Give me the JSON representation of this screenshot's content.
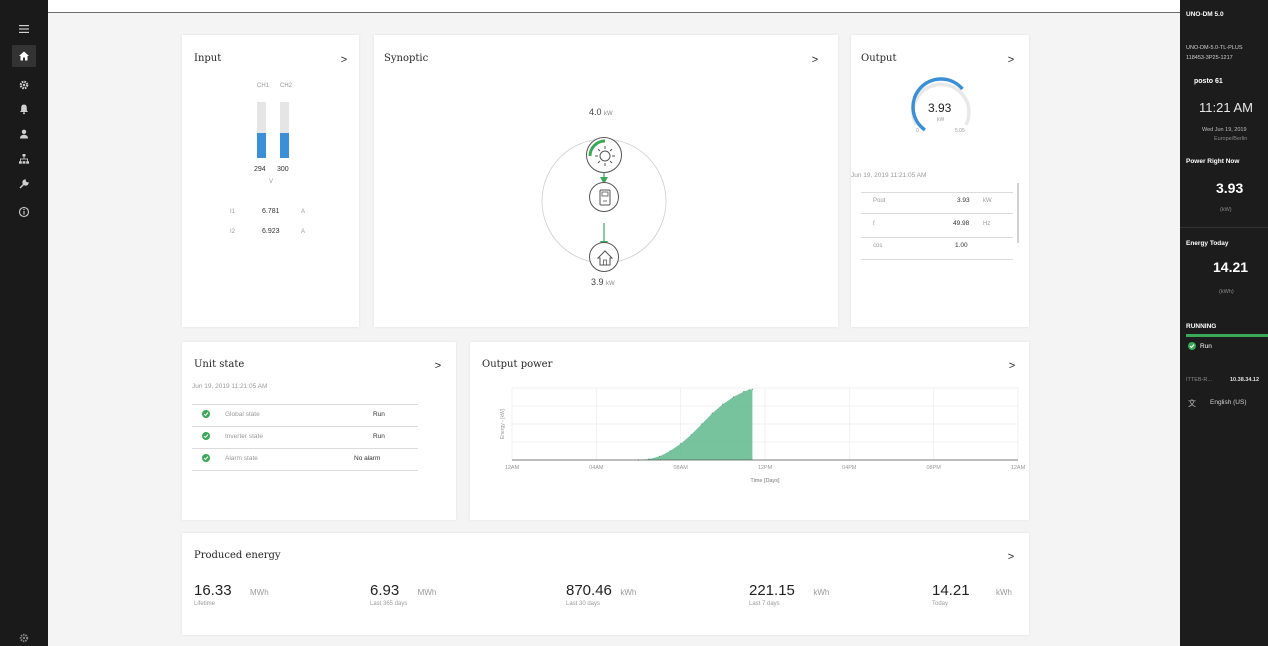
{
  "nav": {
    "items": [
      "menu-icon",
      "home-icon",
      "settings-icon",
      "notifications-icon",
      "user-icon",
      "network-icon",
      "tools-icon",
      "info-icon"
    ],
    "bottom_icon": "gear-icon"
  },
  "input": {
    "title": "Input",
    "channels": [
      "CH1",
      "CH2"
    ],
    "voltages": [
      "294",
      "300"
    ],
    "unit": "V",
    "bar_fill": [
      0.45,
      0.45
    ],
    "currents": [
      {
        "label": "I1",
        "value": "6.781",
        "unit": "A"
      },
      {
        "label": "I2",
        "value": "6.923",
        "unit": "A"
      }
    ]
  },
  "synoptic": {
    "title": "Synoptic",
    "top_value": "4.0",
    "top_unit": "kW",
    "bottom_value": "3.9",
    "bottom_unit": "kW"
  },
  "output": {
    "title": "Output",
    "gauge_value": "3.93",
    "gauge_unit": "kW",
    "gauge_min": "0",
    "gauge_max": "5.05",
    "gauge_fraction": 0.78,
    "timestamp": "Jun 19, 2019 11:21:05 AM",
    "rows": [
      {
        "label": "Pout",
        "value": "3.93",
        "unit": "kW"
      },
      {
        "label": "f",
        "value": "49.98",
        "unit": "Hz"
      },
      {
        "label": "cos",
        "value": "1.00",
        "unit": ""
      }
    ]
  },
  "unit_state": {
    "title": "Unit state",
    "timestamp": "Jun 19, 2019 11:21:05 AM",
    "rows": [
      {
        "label": "Global state",
        "value": "Run"
      },
      {
        "label": "Inverter state",
        "value": "Run"
      },
      {
        "label": "Alarm state",
        "value": "No alarm"
      }
    ]
  },
  "output_power": {
    "title": "Output power",
    "ylabel": "Energy - [kW]",
    "xlabel": "Time [Days]",
    "x_ticks": [
      "12AM",
      "04AM",
      "08AM",
      "12PM",
      "04PM",
      "08PM",
      "12AM"
    ]
  },
  "chart_data": {
    "type": "area",
    "xlabel": "Time [Days]",
    "ylabel": "Energy - [kW]",
    "x": [
      6.0,
      6.5,
      7.0,
      7.5,
      8.0,
      8.5,
      9.0,
      9.5,
      10.0,
      10.5,
      11.0,
      11.25,
      11.4
    ],
    "values": [
      0.0,
      0.05,
      0.2,
      0.5,
      0.9,
      1.4,
      2.0,
      2.6,
      3.1,
      3.5,
      3.8,
      3.9,
      3.93
    ],
    "xlim": [
      0,
      24
    ],
    "ylim": [
      0,
      4
    ],
    "color": "#5fb88c",
    "grid": true
  },
  "produced_energy": {
    "title": "Produced energy",
    "items": [
      {
        "value": "16.33",
        "unit": "MWh",
        "label": "Lifetime"
      },
      {
        "value": "6.93",
        "unit": "MWh",
        "label": "Last 365 days"
      },
      {
        "value": "870.46",
        "unit": "kWh",
        "label": "Last 30 days"
      },
      {
        "value": "221.15",
        "unit": "kWh",
        "label": "Last 7 days"
      },
      {
        "value": "14.21",
        "unit": "kWh",
        "label": "Today"
      }
    ]
  },
  "right_panel": {
    "model": "UNO-DM 5.0",
    "model_full": "UNO-DM-5.0-TL-PLUS",
    "serial": "118453-3P25-1217",
    "site": "posto 61",
    "time": "11:21 AM",
    "date": "Wed Jun 19, 2019",
    "timezone": "Europe/Berlin",
    "power_title": "Power Right Now",
    "power_value": "3.93",
    "power_unit": "(kW)",
    "energy_title": "Energy Today",
    "energy_value": "14.21",
    "energy_unit": "(kWh)",
    "status": "RUNNING",
    "status_detail": "Run",
    "network_name": "ITTEB-R...",
    "ip": "10.38.34.12",
    "language": "English (US)"
  },
  "colors": {
    "accent_blue": "#3a8fd6",
    "green": "#3aa856",
    "area_green": "#5fb88c",
    "dark_bg": "#1a1a1a"
  }
}
